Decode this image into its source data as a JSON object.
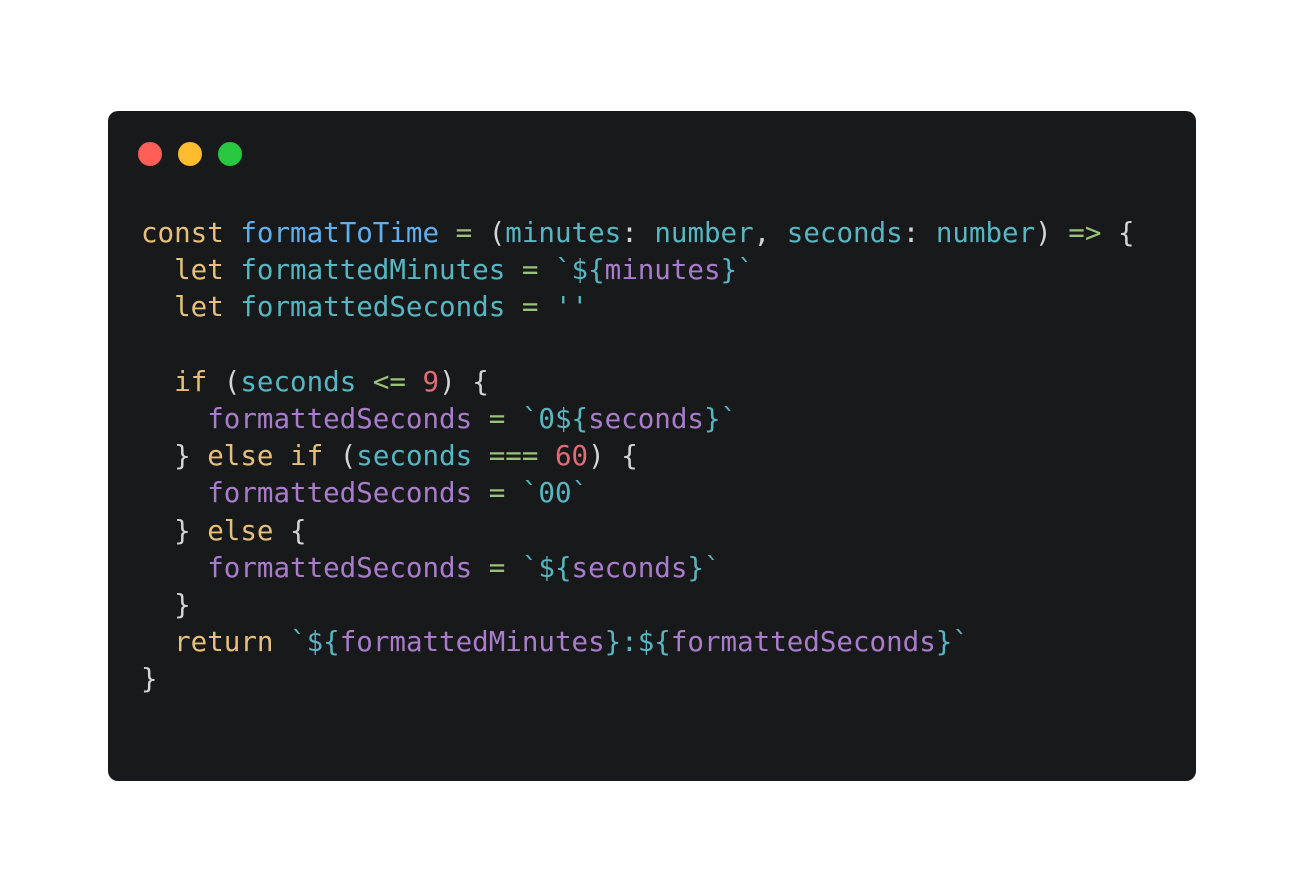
{
  "window": {
    "controls": {
      "close_color": "#ff5f57",
      "minimize_color": "#febc2e",
      "maximize_color": "#28c840"
    }
  },
  "code": {
    "language": "typescript",
    "lines": [
      [
        {
          "t": "const",
          "c": "kw"
        },
        {
          "t": " ",
          "c": "p"
        },
        {
          "t": "formatToTime",
          "c": "fn"
        },
        {
          "t": " ",
          "c": "p"
        },
        {
          "t": "=",
          "c": "op"
        },
        {
          "t": " (",
          "c": "p"
        },
        {
          "t": "minutes",
          "c": "id"
        },
        {
          "t": ": ",
          "c": "p"
        },
        {
          "t": "number",
          "c": "id"
        },
        {
          "t": ", ",
          "c": "p"
        },
        {
          "t": "seconds",
          "c": "id"
        },
        {
          "t": ": ",
          "c": "p"
        },
        {
          "t": "number",
          "c": "id"
        },
        {
          "t": ") ",
          "c": "p"
        },
        {
          "t": "=>",
          "c": "op"
        },
        {
          "t": " {",
          "c": "p"
        }
      ],
      [
        {
          "t": "  ",
          "c": "p"
        },
        {
          "t": "let",
          "c": "kw"
        },
        {
          "t": " ",
          "c": "p"
        },
        {
          "t": "formattedMinutes",
          "c": "id"
        },
        {
          "t": " ",
          "c": "p"
        },
        {
          "t": "=",
          "c": "op"
        },
        {
          "t": " ",
          "c": "p"
        },
        {
          "t": "`",
          "c": "tick"
        },
        {
          "t": "${",
          "c": "str"
        },
        {
          "t": "minutes",
          "c": "var"
        },
        {
          "t": "}",
          "c": "str"
        },
        {
          "t": "`",
          "c": "tick"
        }
      ],
      [
        {
          "t": "  ",
          "c": "p"
        },
        {
          "t": "let",
          "c": "kw"
        },
        {
          "t": " ",
          "c": "p"
        },
        {
          "t": "formattedSeconds",
          "c": "id"
        },
        {
          "t": " ",
          "c": "p"
        },
        {
          "t": "=",
          "c": "op"
        },
        {
          "t": " ",
          "c": "p"
        },
        {
          "t": "''",
          "c": "str"
        }
      ],
      [],
      [
        {
          "t": "  ",
          "c": "p"
        },
        {
          "t": "if",
          "c": "kw"
        },
        {
          "t": " (",
          "c": "p"
        },
        {
          "t": "seconds",
          "c": "id"
        },
        {
          "t": " ",
          "c": "p"
        },
        {
          "t": "<=",
          "c": "op"
        },
        {
          "t": " ",
          "c": "p"
        },
        {
          "t": "9",
          "c": "num"
        },
        {
          "t": ") {",
          "c": "p"
        }
      ],
      [
        {
          "t": "    ",
          "c": "p"
        },
        {
          "t": "formattedSeconds",
          "c": "var"
        },
        {
          "t": " ",
          "c": "p"
        },
        {
          "t": "=",
          "c": "op"
        },
        {
          "t": " ",
          "c": "p"
        },
        {
          "t": "`",
          "c": "tick"
        },
        {
          "t": "0${",
          "c": "str"
        },
        {
          "t": "seconds",
          "c": "var"
        },
        {
          "t": "}",
          "c": "str"
        },
        {
          "t": "`",
          "c": "tick"
        }
      ],
      [
        {
          "t": "  } ",
          "c": "p"
        },
        {
          "t": "else",
          "c": "kw"
        },
        {
          "t": " ",
          "c": "p"
        },
        {
          "t": "if",
          "c": "kw"
        },
        {
          "t": " (",
          "c": "p"
        },
        {
          "t": "seconds",
          "c": "id"
        },
        {
          "t": " ",
          "c": "p"
        },
        {
          "t": "===",
          "c": "op"
        },
        {
          "t": " ",
          "c": "p"
        },
        {
          "t": "60",
          "c": "num"
        },
        {
          "t": ") {",
          "c": "p"
        }
      ],
      [
        {
          "t": "    ",
          "c": "p"
        },
        {
          "t": "formattedSeconds",
          "c": "var"
        },
        {
          "t": " ",
          "c": "p"
        },
        {
          "t": "=",
          "c": "op"
        },
        {
          "t": " ",
          "c": "p"
        },
        {
          "t": "`",
          "c": "tick"
        },
        {
          "t": "00",
          "c": "str"
        },
        {
          "t": "`",
          "c": "tick"
        }
      ],
      [
        {
          "t": "  } ",
          "c": "p"
        },
        {
          "t": "else",
          "c": "kw"
        },
        {
          "t": " {",
          "c": "p"
        }
      ],
      [
        {
          "t": "    ",
          "c": "p"
        },
        {
          "t": "formattedSeconds",
          "c": "var"
        },
        {
          "t": " ",
          "c": "p"
        },
        {
          "t": "=",
          "c": "op"
        },
        {
          "t": " ",
          "c": "p"
        },
        {
          "t": "`",
          "c": "tick"
        },
        {
          "t": "${",
          "c": "str"
        },
        {
          "t": "seconds",
          "c": "var"
        },
        {
          "t": "}",
          "c": "str"
        },
        {
          "t": "`",
          "c": "tick"
        }
      ],
      [
        {
          "t": "  }",
          "c": "p"
        }
      ],
      [
        {
          "t": "  ",
          "c": "p"
        },
        {
          "t": "return",
          "c": "kw"
        },
        {
          "t": " ",
          "c": "p"
        },
        {
          "t": "`",
          "c": "tick"
        },
        {
          "t": "${",
          "c": "str"
        },
        {
          "t": "formattedMinutes",
          "c": "var"
        },
        {
          "t": "}:${",
          "c": "str"
        },
        {
          "t": "formattedSeconds",
          "c": "var"
        },
        {
          "t": "}",
          "c": "str"
        },
        {
          "t": "`",
          "c": "tick"
        }
      ],
      [
        {
          "t": "}",
          "c": "p"
        }
      ]
    ]
  }
}
